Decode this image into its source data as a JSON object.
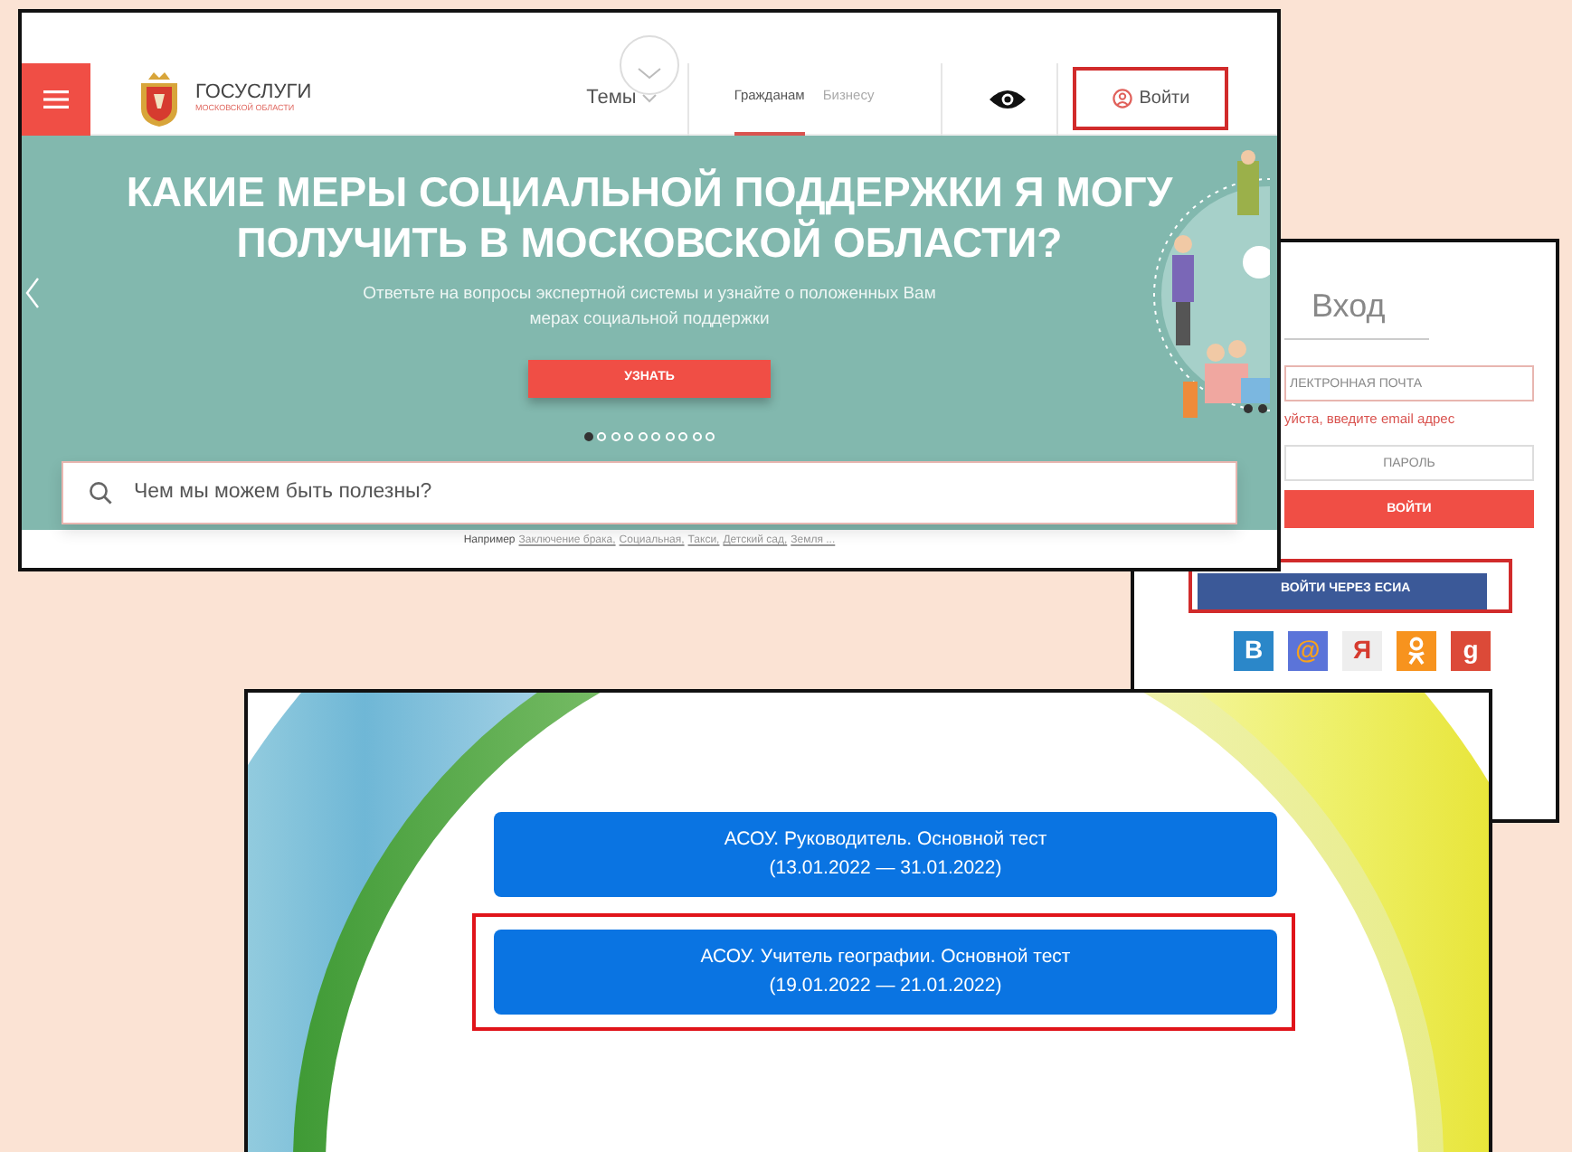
{
  "portal": {
    "brand": {
      "title": "ГОСУСЛУГИ",
      "subtitle": "МОСКОВСКОЙ ОБЛАСТИ"
    },
    "topics": "Темы",
    "audience_tabs": [
      {
        "label": "Гражданам",
        "selected": true
      },
      {
        "label": "Бизнесу",
        "selected": false
      }
    ],
    "login_button": {
      "label": "Войти",
      "highlighted": true
    },
    "hero": {
      "heading": "КАКИЕ МЕРЫ СОЦИАЛЬНОЙ ПОДДЕРЖКИ Я МОГУ ПОЛУЧИТЬ В МОСКОВСКОЙ ОБЛАСТИ?",
      "text": "Ответьте на вопросы экспертной системы и узнайте о положенных Вам мерах социальной поддержки",
      "button": "УЗНАТЬ",
      "slides": [
        {
          "selected": true
        },
        {
          "selected": false
        },
        {
          "selected": false
        },
        {
          "selected": false
        },
        {
          "selected": false
        },
        {
          "selected": false
        },
        {
          "selected": false
        },
        {
          "selected": false
        },
        {
          "selected": false
        },
        {
          "selected": false
        }
      ]
    },
    "search": {
      "placeholder": "Чем мы можем быть полезны?"
    },
    "examples": {
      "label": "Например",
      "links": [
        "Заключение брака,",
        "Социальная,",
        "Такси,",
        "Детский сад,",
        "Земля ..."
      ]
    }
  },
  "login": {
    "title": "Вход",
    "email": {
      "placeholder": "ЛЕКТРОННАЯ ПОЧТА",
      "error": "уйста, введите email адрес"
    },
    "password": {
      "placeholder": "ПАРОЛЬ"
    },
    "submit": "ВОЙТИ",
    "esia": {
      "label": "ВОЙТИ ЧЕРЕЗ ЕСИА",
      "highlighted": true
    },
    "social": [
      {
        "kind": "letter",
        "label": "В",
        "color": "#2b87c9"
      },
      {
        "kind": "letter",
        "label": "@",
        "color": "#5b74d9"
      },
      {
        "kind": "letter",
        "label": "Я",
        "color": "#eeeeee"
      },
      {
        "kind": "ok",
        "color": "#f7931e"
      },
      {
        "kind": "letter",
        "label": "g",
        "color": "#dc4a38"
      }
    ]
  },
  "tests": [
    {
      "title": "АСОУ. Руководитель. Основной тест",
      "dates": "(13.01.2022 — 31.01.2022)",
      "highlighted": false
    },
    {
      "title": "АСОУ. Учитель географии. Основной тест",
      "dates": "(19.01.2022 — 21.01.2022)",
      "highlighted": true
    }
  ]
}
